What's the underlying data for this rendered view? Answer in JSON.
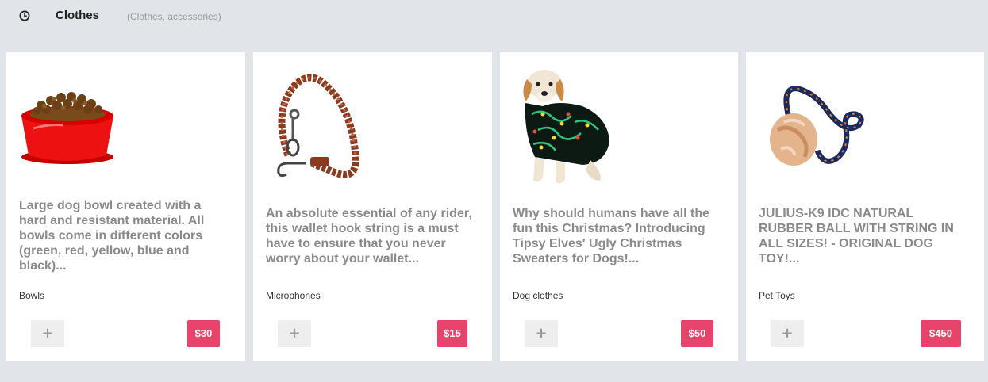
{
  "header": {
    "title": "Clothes",
    "subtitle": "(Clothes, accessories)",
    "icon": "clock-icon"
  },
  "products": [
    {
      "description": "Large dog bowl created with a hard and resistant material. All bowls come in different colors (green, red, yellow, blue and black)...",
      "category": "Bowls",
      "add_label": "+",
      "price": "$30",
      "image": "dog-bowl-image"
    },
    {
      "description": "An absolute essential of any rider, this wallet hook string is a must have to ensure that you never worry about your wallet...",
      "category": "Microphones",
      "add_label": "+",
      "price": "$15",
      "image": "wallet-hook-string-image"
    },
    {
      "description": "Why should humans have all the fun this Christmas? Introducing Tipsy Elves' Ugly Christmas Sweaters for Dogs!...",
      "category": "Dog clothes",
      "add_label": "+",
      "price": "$50",
      "image": "dog-christmas-sweater-image"
    },
    {
      "description": "JULIUS-K9 IDC NATURAL RUBBER BALL WITH STRING IN ALL SIZES! - ORIGINAL DOG TOY!...",
      "category": "Pet Toys",
      "add_label": "+",
      "price": "$450",
      "image": "rubber-ball-string-image"
    }
  ],
  "colors": {
    "background": "#e1e4e8",
    "card": "#ffffff",
    "price_badge": "#e8436a",
    "add_button": "#eeeeee",
    "description_text": "#8a8a8a"
  }
}
